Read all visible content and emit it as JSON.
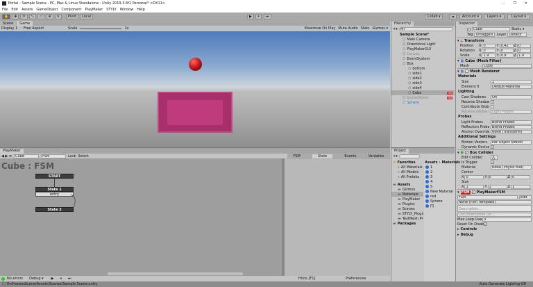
{
  "window": {
    "title": "Portal - Sample Scene - PC, Mac & Linux Standalone - Unity 2019.3.6f1 Personal* <DX11>",
    "minimize": "–",
    "maximize": "❐",
    "close": "✕"
  },
  "menu": [
    "File",
    "Edit",
    "Assets",
    "GameObject",
    "Component",
    "PlayMaker",
    "STYLY",
    "Window",
    "Help"
  ],
  "toolbar": {
    "tools": [
      "✋",
      "✥",
      "⟳",
      "⤡",
      "▭",
      "⊕",
      "✕"
    ],
    "pivot": "Pivot",
    "local": "Local",
    "collab": "Collab ▾",
    "cloud": "☁",
    "account": "Account ▾",
    "layers": "Layers ▾",
    "layout": "Layout ▾",
    "play": "▶",
    "pause": "⏸",
    "step": "⏭"
  },
  "game": {
    "tabs": [
      "Scene",
      "Game"
    ],
    "display": "Display 1",
    "aspect": "Free Aspect",
    "scale_label": "Scale",
    "scale_value": "1x",
    "buttons": [
      "Maximize On Play",
      "Mute Audio",
      "Stats",
      "Gizmos ▾"
    ],
    "sphere_color": "#c0141a",
    "box_color": "#b0336d"
  },
  "hierarchy": {
    "tab": "Hierarchy",
    "search": "All",
    "scene": "Sample Scene*",
    "items": [
      {
        "label": "Main Camera",
        "indent": 1
      },
      {
        "label": "Directional Light",
        "indent": 1
      },
      {
        "label": "PlayMakerGUI",
        "indent": 1
      },
      {
        "label": "Canvas",
        "indent": 1,
        "disabled": true
      },
      {
        "label": "EventSystem",
        "indent": 1
      },
      {
        "label": "Box",
        "indent": 1
      },
      {
        "label": "bottom",
        "indent": 2
      },
      {
        "label": "side1",
        "indent": 2
      },
      {
        "label": "side2",
        "indent": 2
      },
      {
        "label": "side3",
        "indent": 2
      },
      {
        "label": "side4",
        "indent": 2
      },
      {
        "label": "Cube",
        "indent": 2,
        "selected": true,
        "badge": "FSM"
      },
      {
        "label": "GameObject",
        "indent": 1,
        "disabled": true,
        "badge": "FSM"
      },
      {
        "label": "Sphere",
        "indent": 1,
        "blue": true
      }
    ]
  },
  "inspector": {
    "tab": "Inspector",
    "name": "Cube",
    "static": "Static ▾",
    "tag_label": "Tag",
    "tag": "Untagged",
    "layer_label": "Layer",
    "layer": "Default",
    "transform": {
      "title": "Transform",
      "rows": [
        {
          "label": "Position",
          "x": "0",
          "y": "0.42",
          "z": "0"
        },
        {
          "label": "Rotation",
          "x": "0",
          "y": "0",
          "z": "0"
        },
        {
          "label": "Scale",
          "x": "1.9",
          "y": "0.9",
          "z": "1.9"
        }
      ]
    },
    "mesh_filter": {
      "title": "Cube (Mesh Filter)",
      "mesh_label": "Mesh",
      "mesh": "Cube"
    },
    "mesh_renderer": {
      "title": "Mesh Renderer",
      "materials": "Materials",
      "size_label": "Size",
      "size": "1",
      "element_label": "Element 0",
      "element": "Default-Material",
      "lighting": "Lighting",
      "cast_label": "Cast Shadows",
      "cast": "On",
      "receive_label": "Receive Shadows",
      "contribute_label": "Contribute Global I",
      "receive_gi_label": "Receive Global Illu",
      "receive_gi": "Light Probes",
      "probes": "Probes",
      "light_probes_label": "Light Probes",
      "light_probes": "Blend Probes",
      "reflection_label": "Reflection Probes",
      "reflection": "Blend Probes",
      "anchor_label": "Anchor Override",
      "anchor": "None (Transform)",
      "additional": "Additional Settings",
      "motion_label": "Motion Vectors",
      "motion": "Per Object Motion",
      "occlusion_label": "Dynamic Occlusion"
    },
    "box_collider": {
      "title": "Box Collider",
      "edit_label": "Edit Collider",
      "trigger_label": "Is Trigger",
      "material_label": "Material",
      "material": "None (Physic Mat)",
      "center_label": "Center",
      "center": {
        "x": "0",
        "y": "0",
        "z": "0"
      },
      "size_label": "Size",
      "size": {
        "x": "1",
        "y": "1",
        "z": "1"
      }
    },
    "fsm": {
      "title": "PlayMakerFSM",
      "name": "FSM",
      "edit": "Edit",
      "template": "None (Fsm Template)",
      "description": "Description...",
      "doc_url": "Documentation Url...",
      "max_loop_label": "Max Loop Overri",
      "max_loop": "0",
      "reset_label": "Reset On Disable",
      "controls": "Controls",
      "debug": "Debug"
    }
  },
  "playmaker": {
    "tab": "PlayMaker",
    "object": "Cube",
    "fsm": "FSM",
    "lock": "Lock",
    "select": "Select",
    "heading": "Cube : FSM",
    "nodes": {
      "start": "START",
      "state1": "State 1",
      "entry": "entry",
      "state2": "State 2"
    },
    "side_tabs": [
      "FSM",
      "State",
      "Events",
      "Variables"
    ],
    "hints": "Hints [F1]",
    "preferences": "Preferences",
    "errors": "No errors",
    "debug": "Debug ▾"
  },
  "project": {
    "tab": "Project",
    "favorites": "Favorites",
    "fav_items": [
      "All Materials",
      "All Models",
      "All Prefabs"
    ],
    "assets": "Assets",
    "asset_items": [
      "Gizmos",
      "Materials",
      "PlayMaker",
      "Plugins",
      "Scenes",
      "STYLY_Plugin",
      "TextMesh Pro"
    ],
    "packages": "Packages",
    "breadcrumb": [
      "Assets",
      "Materials"
    ],
    "files": [
      "1",
      "2",
      "3",
      "4",
      "5",
      "New Material",
      "red",
      "Sphere",
      "円"
    ]
  },
  "status": {
    "message": "OnProcessScene/Assets/Scenes/Sample Scene.unity",
    "lighting": "Auto Generate Lighting Off"
  }
}
